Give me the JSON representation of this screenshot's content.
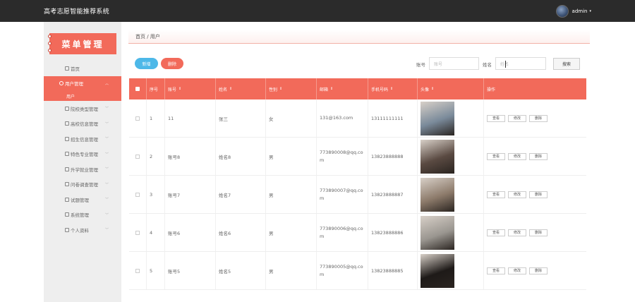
{
  "header": {
    "app_title": "高考志愿智能推荐系统",
    "user_name": "admin",
    "caret": "▾"
  },
  "sidebar": {
    "menu_title": "菜单管理",
    "items": [
      {
        "label": "首页",
        "icon": "home-icon",
        "expandable": false,
        "active": false
      },
      {
        "label": "用户管理",
        "icon": "user-icon",
        "expandable": true,
        "active": true,
        "submenu": [
          "用户"
        ]
      },
      {
        "label": "院校类型管理",
        "icon": "grid-icon",
        "expandable": true,
        "active": false
      },
      {
        "label": "高校信息管理",
        "icon": "school-icon",
        "expandable": true,
        "active": false
      },
      {
        "label": "招生信息管理",
        "icon": "doc-icon",
        "expandable": true,
        "active": false
      },
      {
        "label": "特色专业管理",
        "icon": "book-icon",
        "expandable": true,
        "active": false
      },
      {
        "label": "升学就业管理",
        "icon": "briefcase-icon",
        "expandable": true,
        "active": false
      },
      {
        "label": "问卷调查管理",
        "icon": "survey-icon",
        "expandable": true,
        "active": false
      },
      {
        "label": "试题管理",
        "icon": "chart-icon",
        "expandable": true,
        "active": false
      },
      {
        "label": "系统管理",
        "icon": "settings-icon",
        "expandable": true,
        "active": false
      },
      {
        "label": "个人资料",
        "icon": "profile-icon",
        "expandable": true,
        "active": false
      }
    ]
  },
  "breadcrumb": "首页 / 用户",
  "toolbar": {
    "add_label": "新增",
    "delete_label": "删除",
    "account_label": "账号",
    "account_placeholder": "账号",
    "name_label": "姓名",
    "name_placeholder": "姓名",
    "search_label": "搜索"
  },
  "table": {
    "columns": [
      "序号",
      "账号",
      "姓名",
      "性别",
      "邮箱",
      "手机号码",
      "头像",
      "操作"
    ],
    "sort_glyph": "⇕",
    "actions": [
      "查看",
      "修改",
      "删除"
    ],
    "rows": [
      {
        "index": "1",
        "account": "11",
        "name": "张三",
        "gender": "女",
        "email": "131@163.com",
        "phone": "13111111111",
        "photo_color": "#7a8a9a"
      },
      {
        "index": "2",
        "account": "账号8",
        "name": "姓名8",
        "gender": "男",
        "email": "773890008@qq.com",
        "phone": "13823888888",
        "photo_color": "#5a4a42"
      },
      {
        "index": "3",
        "account": "账号7",
        "name": "姓名7",
        "gender": "男",
        "email": "773890007@qq.com",
        "phone": "13823888887",
        "photo_color": "#8c7a6a"
      },
      {
        "index": "4",
        "account": "账号6",
        "name": "姓名6",
        "gender": "男",
        "email": "773890006@qq.com",
        "phone": "13823888886",
        "photo_color": "#9a9690"
      },
      {
        "index": "5",
        "account": "账号5",
        "name": "姓名5",
        "gender": "男",
        "email": "773890005@qq.com",
        "phone": "13823888885",
        "photo_color": "#1e1a18"
      }
    ]
  }
}
